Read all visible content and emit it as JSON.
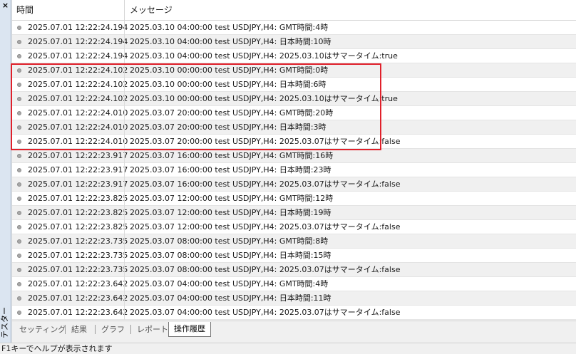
{
  "side_panel": {
    "close_glyph": "×",
    "label": "テスター"
  },
  "columns": {
    "time": "時間",
    "message": "メッセージ"
  },
  "rows": [
    {
      "time": "2025.07.01 12:22:24.194",
      "message": "2025.03.10 04:00:00  test USDJPY,H4: GMT時間:4時"
    },
    {
      "time": "2025.07.01 12:22:24.194",
      "message": "2025.03.10 04:00:00  test USDJPY,H4: 日本時間:10時"
    },
    {
      "time": "2025.07.01 12:22:24.194",
      "message": "2025.03.10 04:00:00  test USDJPY,H4: 2025.03.10はサマータイム:true"
    },
    {
      "time": "2025.07.01 12:22:24.102",
      "message": "2025.03.10 00:00:00  test USDJPY,H4: GMT時間:0時"
    },
    {
      "time": "2025.07.01 12:22:24.102",
      "message": "2025.03.10 00:00:00  test USDJPY,H4: 日本時間:6時"
    },
    {
      "time": "2025.07.01 12:22:24.102",
      "message": "2025.03.10 00:00:00  test USDJPY,H4: 2025.03.10はサマータイム:true"
    },
    {
      "time": "2025.07.01 12:22:24.010",
      "message": "2025.03.07 20:00:00  test USDJPY,H4: GMT時間:20時"
    },
    {
      "time": "2025.07.01 12:22:24.010",
      "message": "2025.03.07 20:00:00  test USDJPY,H4: 日本時間:3時"
    },
    {
      "time": "2025.07.01 12:22:24.010",
      "message": "2025.03.07 20:00:00  test USDJPY,H4: 2025.03.07はサマータイム:false"
    },
    {
      "time": "2025.07.01 12:22:23.917",
      "message": "2025.03.07 16:00:00  test USDJPY,H4: GMT時間:16時"
    },
    {
      "time": "2025.07.01 12:22:23.917",
      "message": "2025.03.07 16:00:00  test USDJPY,H4: 日本時間:23時"
    },
    {
      "time": "2025.07.01 12:22:23.917",
      "message": "2025.03.07 16:00:00  test USDJPY,H4: 2025.03.07はサマータイム:false"
    },
    {
      "time": "2025.07.01 12:22:23.825",
      "message": "2025.03.07 12:00:00  test USDJPY,H4: GMT時間:12時"
    },
    {
      "time": "2025.07.01 12:22:23.825",
      "message": "2025.03.07 12:00:00  test USDJPY,H4: 日本時間:19時"
    },
    {
      "time": "2025.07.01 12:22:23.825",
      "message": "2025.03.07 12:00:00  test USDJPY,H4: 2025.03.07はサマータイム:false"
    },
    {
      "time": "2025.07.01 12:22:23.735",
      "message": "2025.03.07 08:00:00  test USDJPY,H4: GMT時間:8時"
    },
    {
      "time": "2025.07.01 12:22:23.735",
      "message": "2025.03.07 08:00:00  test USDJPY,H4: 日本時間:15時"
    },
    {
      "time": "2025.07.01 12:22:23.735",
      "message": "2025.03.07 08:00:00  test USDJPY,H4: 2025.03.07はサマータイム:false"
    },
    {
      "time": "2025.07.01 12:22:23.642",
      "message": "2025.03.07 04:00:00  test USDJPY,H4: GMT時間:4時"
    },
    {
      "time": "2025.07.01 12:22:23.642",
      "message": "2025.03.07 04:00:00  test USDJPY,H4: 日本時間:11時"
    },
    {
      "time": "2025.07.01 12:22:23.642",
      "message": "2025.03.07 04:00:00  test USDJPY,H4: 2025.03.07はサマータイム:false"
    }
  ],
  "tabs": [
    {
      "label": "セッティング",
      "active": false
    },
    {
      "label": "結果",
      "active": false
    },
    {
      "label": "グラフ",
      "active": false
    },
    {
      "label": "レポート",
      "active": false
    },
    {
      "label": "操作履歴",
      "active": true
    }
  ],
  "status_text": "F1キーでヘルプが表示されます",
  "colors": {
    "highlight_border": "#e0202a",
    "row_alt": "#f0f0f0",
    "side_panel": "#dbe5f1"
  }
}
